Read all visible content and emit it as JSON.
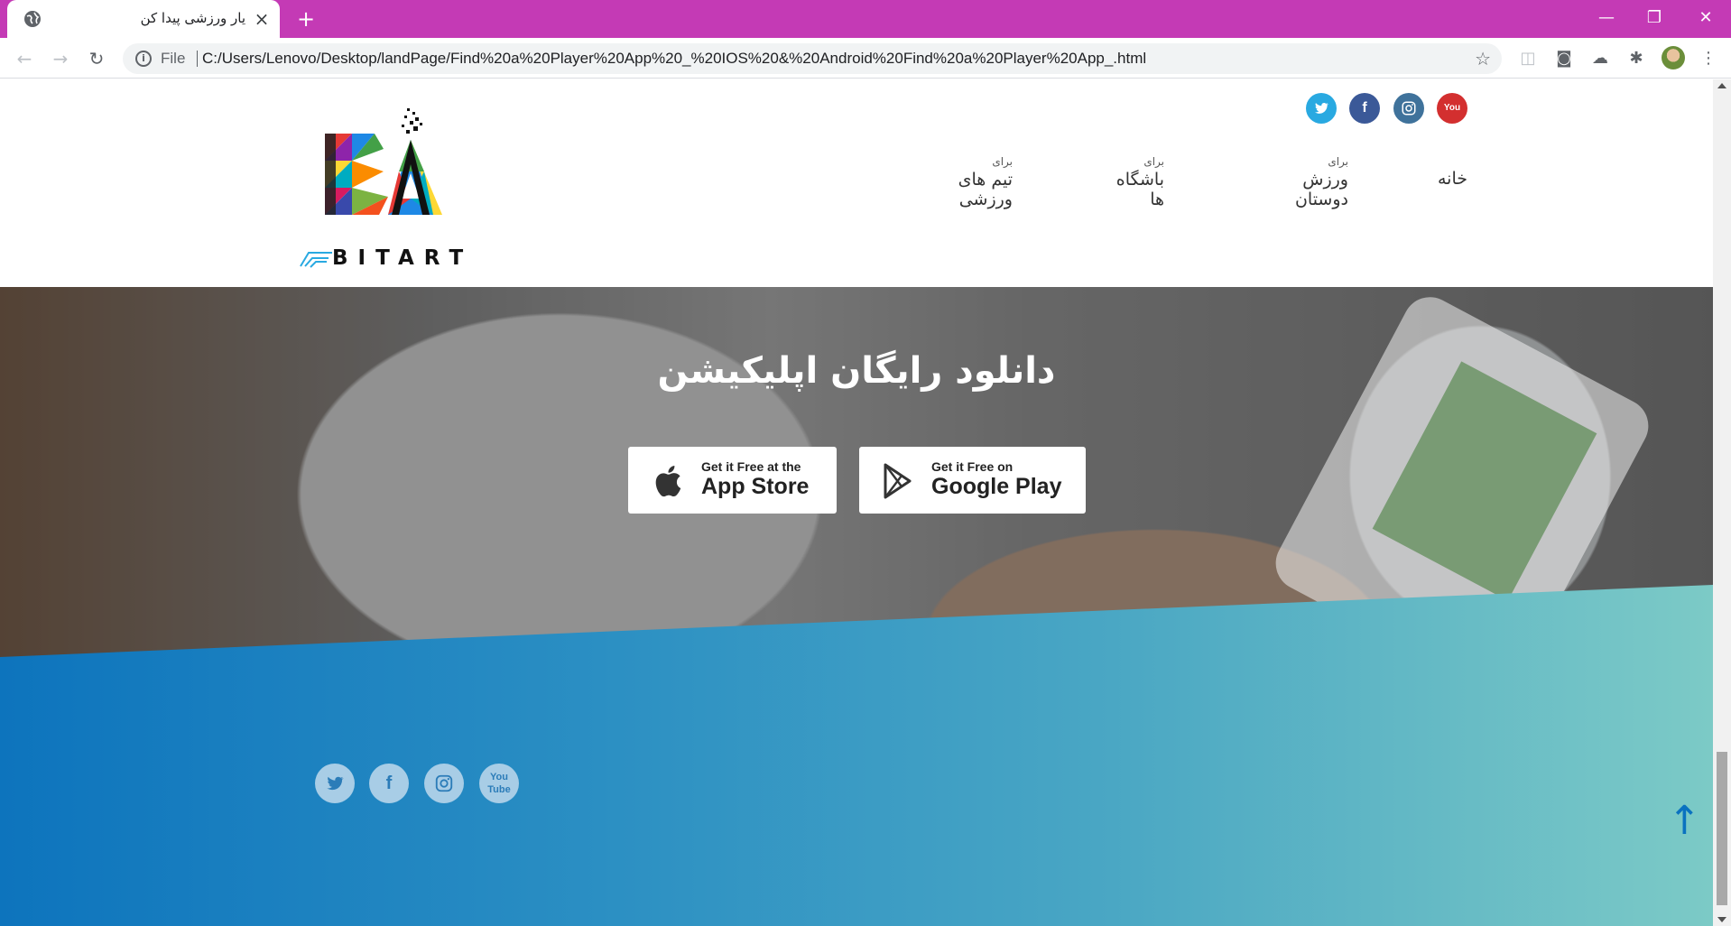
{
  "browser": {
    "tab_title": "یار ورزشی پیدا کن",
    "file_label": "File",
    "url": "C:/Users/Lenovo/Desktop/landPage/Find%20a%20Player%20App%20_%20IOS%20&%20Android%20Find%20a%20Player%20App_.html"
  },
  "nav": {
    "home": "خانه",
    "items": [
      {
        "small": "برای",
        "label": "ورزش دوستان"
      },
      {
        "small": "برای",
        "label": "باشگاه ها"
      },
      {
        "small": "برای",
        "label": "تیم های ورزشی"
      }
    ]
  },
  "logo": {
    "text": "BITART"
  },
  "hero": {
    "title": "دانلود رایگان اپلیکیشن",
    "appstore_small": "Get it Free at the",
    "appstore_big": "App Store",
    "googleplay_small": "Get it Free on",
    "googleplay_big": "Google Play"
  },
  "social_icons": [
    "twitter-icon",
    "facebook-icon",
    "instagram-icon",
    "youtube-icon"
  ],
  "colors": {
    "tabbar": "#c43ab5",
    "twitter": "#29a9e1",
    "facebook": "#3b5998",
    "instagram": "#3f729b",
    "youtube": "#d32f2f",
    "footer_start": "#0d74bd",
    "footer_end": "#7ccac6"
  }
}
